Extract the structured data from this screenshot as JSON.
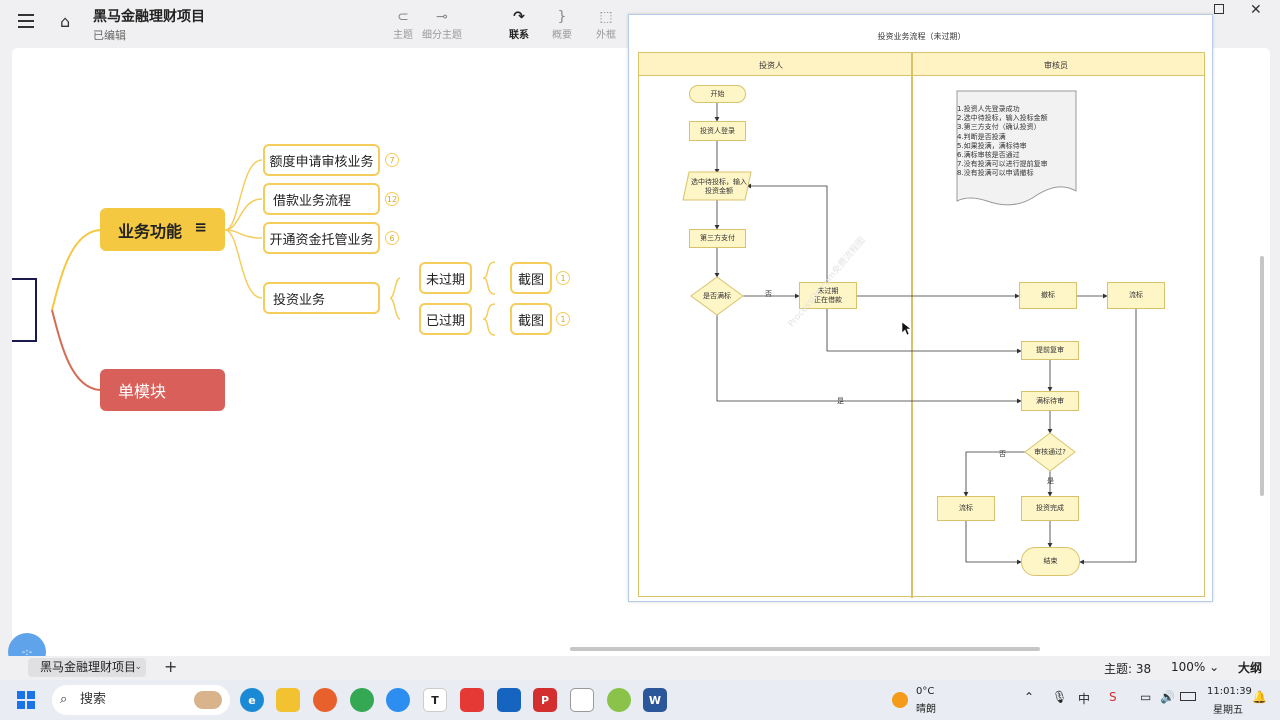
{
  "app": {
    "title": "黑马金融理财项目",
    "status": "已编辑"
  },
  "toolbar": [
    {
      "label": "主题",
      "icon": "topic-icon",
      "glyph": "⊂"
    },
    {
      "label": "细分主题",
      "icon": "subtopic-icon",
      "glyph": "⊸"
    },
    {
      "label": "联系",
      "icon": "relation-icon",
      "glyph": "↷"
    },
    {
      "label": "概要",
      "icon": "summary-icon",
      "glyph": "}"
    },
    {
      "label": "外框",
      "icon": "boundary-icon",
      "glyph": "⬚"
    }
  ],
  "mindmap": {
    "main_nodes": [
      "业务功能",
      "单模块"
    ],
    "sub_nodes": [
      {
        "label": "额度申请审核业务",
        "badge": "7"
      },
      {
        "label": "借款业务流程",
        "badge": "12"
      },
      {
        "label": "开通资金托管业务",
        "badge": "6"
      },
      {
        "label": "投资业务",
        "badge": ""
      }
    ],
    "invest_children": [
      "未过期",
      "已过期"
    ],
    "leaf": [
      {
        "label": "截图",
        "badge": "1"
      },
      {
        "label": "截图",
        "badge": "1"
      }
    ]
  },
  "flowchart": {
    "title": "投资业务流程（未过期）",
    "lanes": [
      "投资人",
      "审核员"
    ],
    "nodes": {
      "start": "开始",
      "login": "投资人登录",
      "select": "选中待投标，输入投资金额",
      "pay": "第三方支付",
      "full_q": "是否满标",
      "pending": "未过期\n正在借款",
      "revoke": "撤标",
      "flow1": "流标",
      "early": "提前复审",
      "full_wait": "满标待审",
      "review_q": "审核通过?",
      "flow2": "流标",
      "done": "投资完成",
      "end": "结束"
    },
    "edge_labels": {
      "no1": "否",
      "yes1": "是",
      "no2": "否",
      "yes2": "是"
    },
    "note": [
      "1.投资人先登录成功",
      "2.选中待投标，输入投标金额",
      "3.第三方支付（确认投资）",
      "4.判断是否投满",
      "5.如果投满，满标待审",
      "6.满标审核是否通过",
      "7.没有投满可以进行提前复审",
      "8.没有投满可以申请撤标"
    ],
    "watermark": "ProcessOn.com免费流程图"
  },
  "status": {
    "tab": "黑马金融理财项目",
    "topics": "主题: 38",
    "zoom": "100%",
    "outline": "大纲"
  },
  "taskbar": {
    "search": "搜索",
    "weather_temp": "0°C",
    "weather_desc": "晴朗",
    "time": "11:01:39",
    "day": "星期五"
  }
}
